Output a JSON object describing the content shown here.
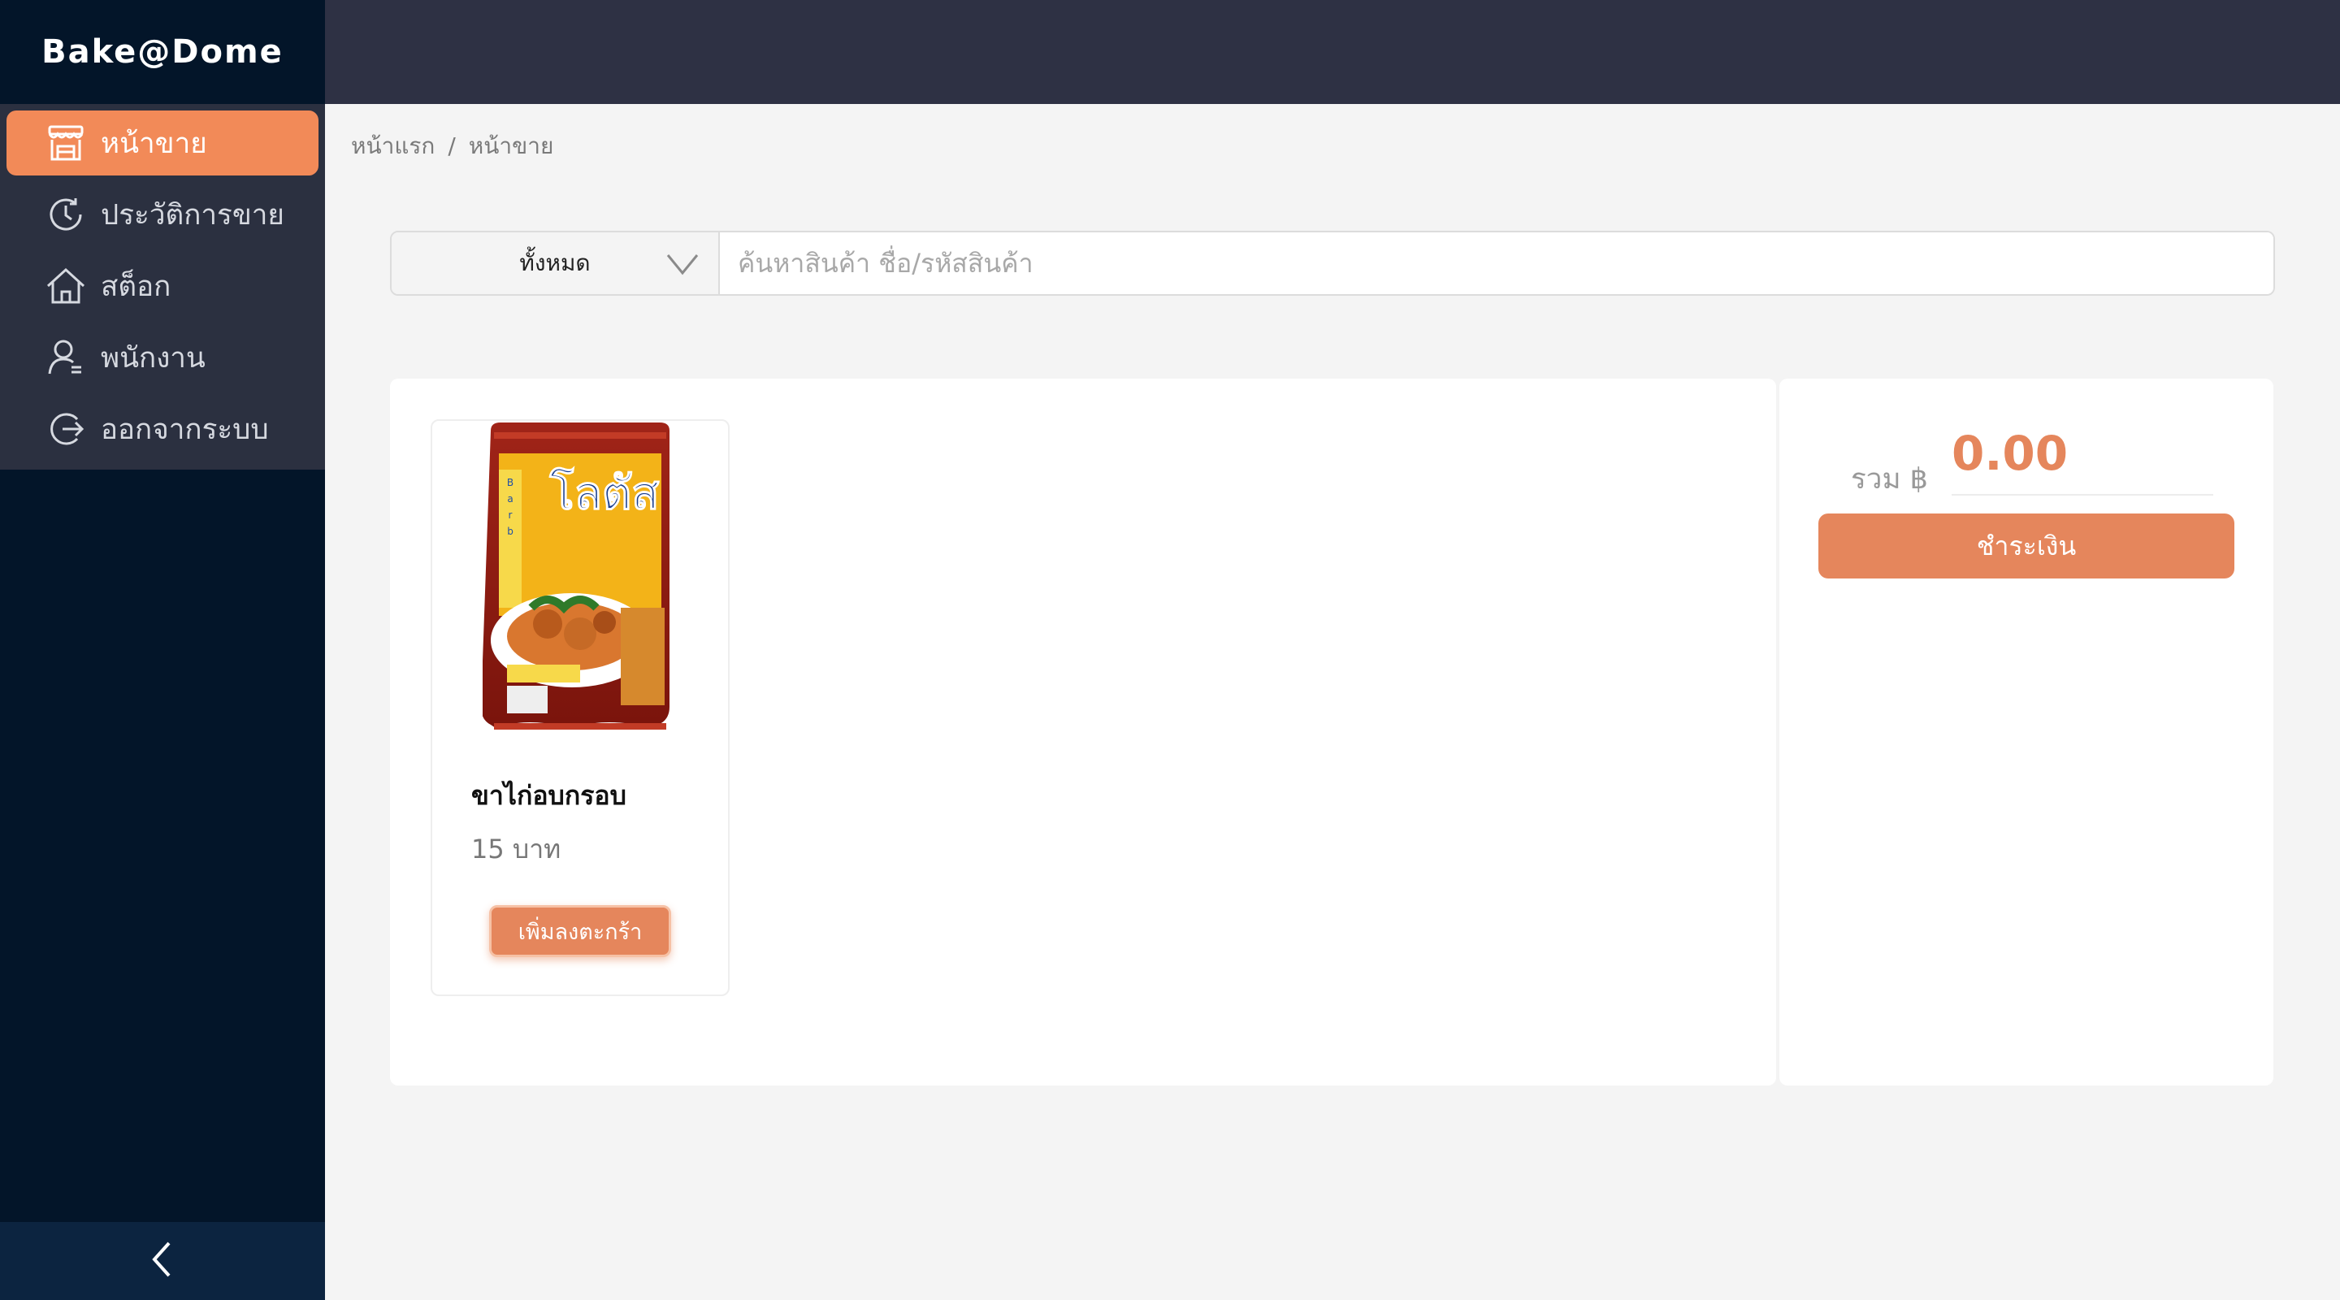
{
  "brand": {
    "name": "Bake@Dome"
  },
  "sidebar": {
    "items": [
      {
        "label": "หน้าขาย",
        "icon": "store-icon",
        "active": true
      },
      {
        "label": "ประวัติการขาย",
        "icon": "clock-icon",
        "active": false
      },
      {
        "label": "สต็อก",
        "icon": "home-icon",
        "active": false
      },
      {
        "label": "พนักงาน",
        "icon": "user-icon",
        "active": false
      },
      {
        "label": "ออกจากระบบ",
        "icon": "logout-icon",
        "active": false
      }
    ],
    "collapse_icon": "chevron-left-icon"
  },
  "breadcrumb": {
    "home": "หน้าแรก",
    "separator": "/",
    "current": "หน้าขาย"
  },
  "search": {
    "category_selected": "ทั้งหมด",
    "placeholder": "ค้นหาสินค้า ชื่อ/รหัสสินค้า",
    "value": ""
  },
  "products": [
    {
      "name": "ขาไก่อบกรอบ",
      "price": "15 บาท",
      "add_label": "เพิ่มลงตะกร้า",
      "image_text": "โลตัส"
    }
  ],
  "cart": {
    "total_label": "รวม ฿",
    "total_value": "0.00",
    "pay_label": "ชำระเงิน"
  },
  "colors": {
    "accent": "#e5865c",
    "active_menu": "#f28a58",
    "sidebar_bg": "#031529",
    "topbar_bg": "#2e3144"
  }
}
